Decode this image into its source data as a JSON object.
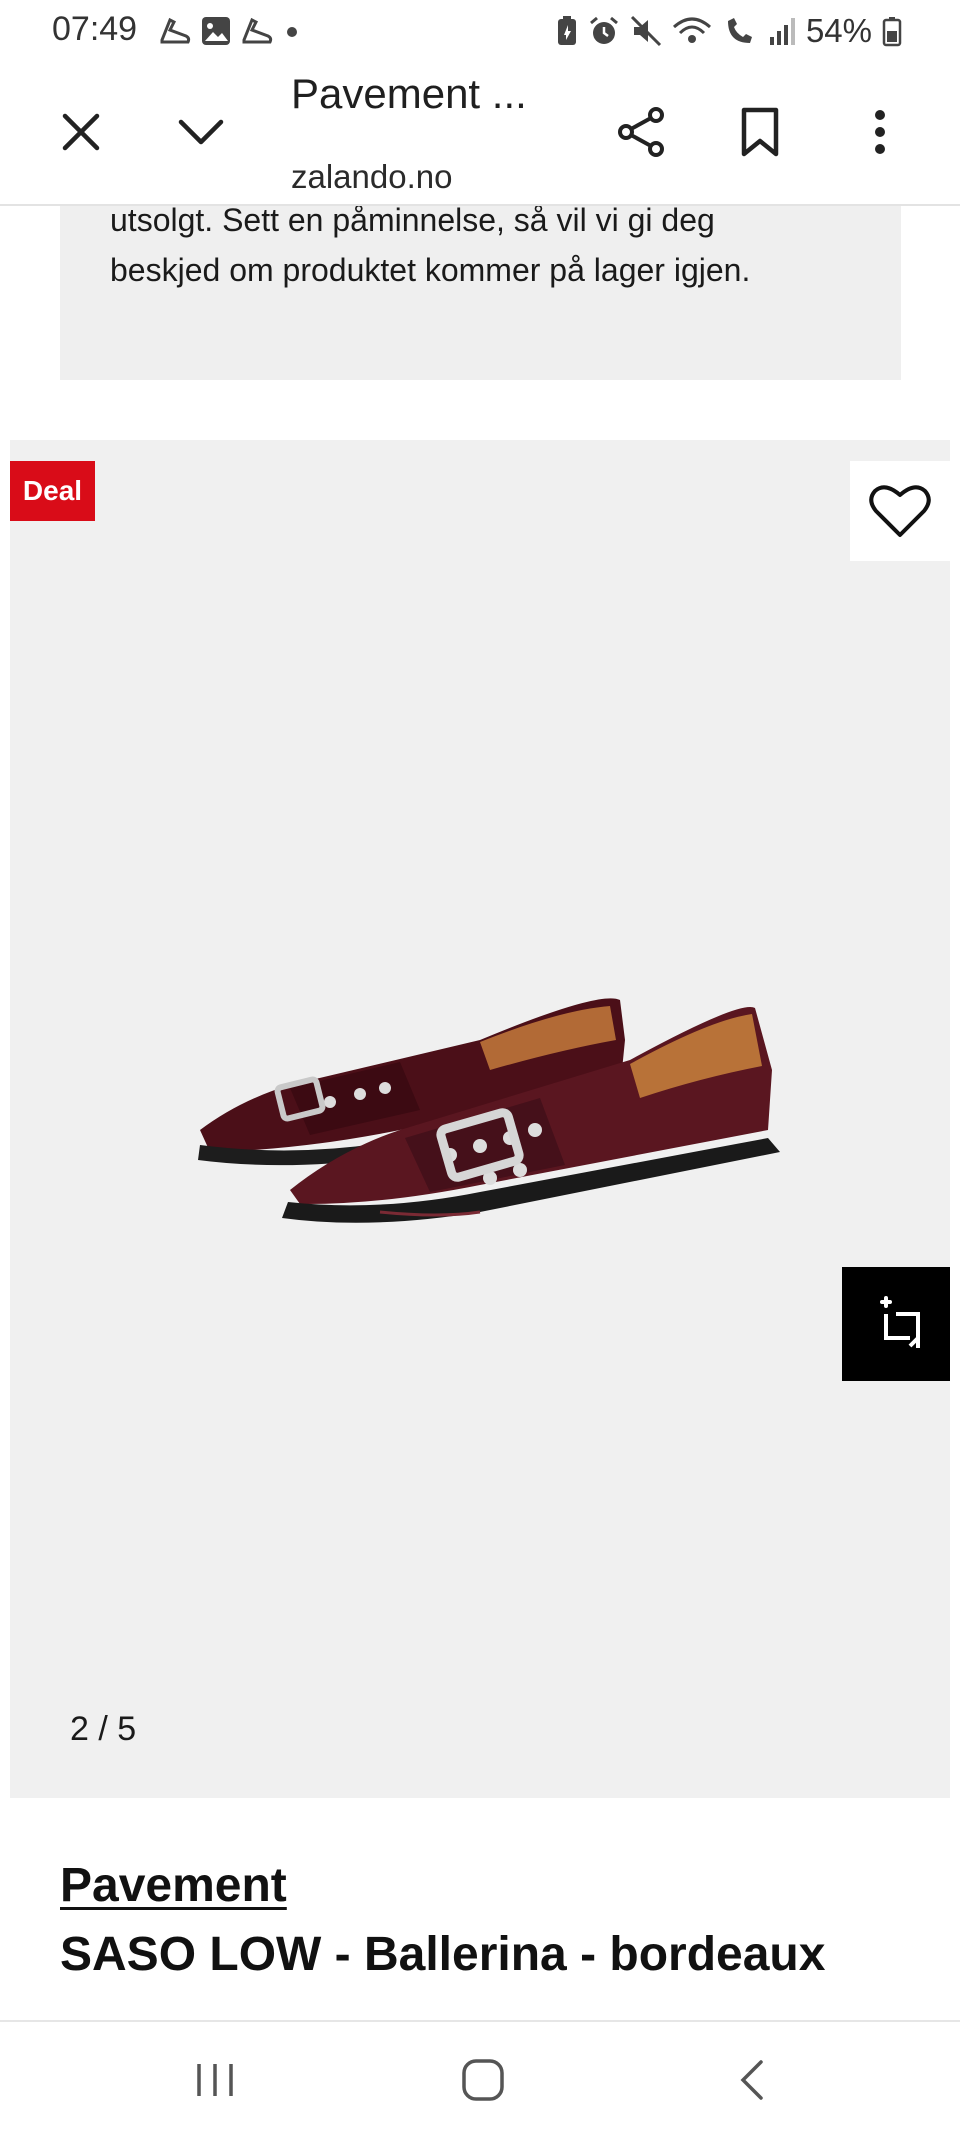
{
  "status_bar": {
    "time": "07:49",
    "battery": "54%",
    "icons_left": [
      "shoe-icon",
      "gallery-icon",
      "shoe-icon",
      "dot-icon"
    ],
    "icons_right": [
      "battery-saver-icon",
      "alarm-icon",
      "mute-icon",
      "wifi-calling-icon",
      "volte-icon",
      "signal-icon",
      "battery-icon"
    ]
  },
  "app_bar": {
    "title": "Pavement ...",
    "domain": "zalando.no",
    "actions": [
      "close-icon",
      "chevron-down-icon",
      "share-icon",
      "bookmark-icon",
      "more-vert-icon"
    ]
  },
  "banner": {
    "text": "utsolgt. Sett en påminnelse, så vil vi gi deg beskjed om produktet kommer på lager igjen."
  },
  "gallery": {
    "badge": "Deal",
    "counter": "2 / 5",
    "product_color": "#5a1620"
  },
  "product": {
    "brand": "Pavement",
    "name": "SASO LOW - Ballerina - bordeaux"
  },
  "colors": {
    "deal_red": "#d90c18",
    "gallery_bg": "#f0f0f0",
    "banner_bg": "#efefef"
  }
}
